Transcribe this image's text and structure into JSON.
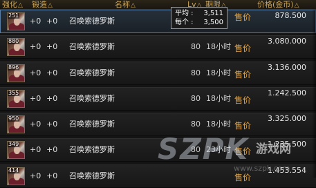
{
  "header": {
    "col_strengthen": "强化",
    "col_forge": "锻造",
    "col_name": "名称",
    "col_lv": "Lv",
    "col_duration": "期限",
    "col_price": "价格(金币)",
    "sort_indicator": "△"
  },
  "tooltip": {
    "avg_label": "平均 :",
    "avg_value": "3,511",
    "each_label": "每个 :",
    "each_value": "3,500"
  },
  "rows": [
    {
      "count": "251",
      "strengthen": "+0",
      "forge": "+0",
      "name": "召唤索德罗斯",
      "lv": "",
      "duration": "",
      "sell": "售价",
      "price": "878.500"
    },
    {
      "count": "880",
      "strengthen": "+0",
      "forge": "+0",
      "name": "召唤索德罗斯",
      "lv": "80",
      "duration": "18小时",
      "sell": "售价",
      "price": "3.080.000"
    },
    {
      "count": "896",
      "strengthen": "+0",
      "forge": "+0",
      "name": "召唤索德罗斯",
      "lv": "80",
      "duration": "18小时",
      "sell": "售价",
      "price": "3.136.000"
    },
    {
      "count": "355",
      "strengthen": "+0",
      "forge": "+0",
      "name": "召唤索德罗斯",
      "lv": "80",
      "duration": "18小时",
      "sell": "售价",
      "price": "1.242.500"
    },
    {
      "count": "950",
      "strengthen": "+0",
      "forge": "+0",
      "name": "召唤索德罗斯",
      "lv": "80",
      "duration": "18小时",
      "sell": "售价",
      "price": "3.325.000"
    },
    {
      "count": "349",
      "strengthen": "+0",
      "forge": "+0",
      "name": "召唤索德罗斯",
      "lv": "80",
      "duration": "23小时",
      "sell": "售价",
      "price": "1.235.500"
    },
    {
      "count": "414",
      "strengthen": "+0",
      "forge": "+0",
      "name": "召唤索德罗斯",
      "lv": "",
      "duration": "",
      "sell": "售价",
      "price": "1.453.554"
    }
  ],
  "watermark": {
    "logo": "SZPK",
    "site": "游戏网",
    "url": "www.szpk.com"
  }
}
